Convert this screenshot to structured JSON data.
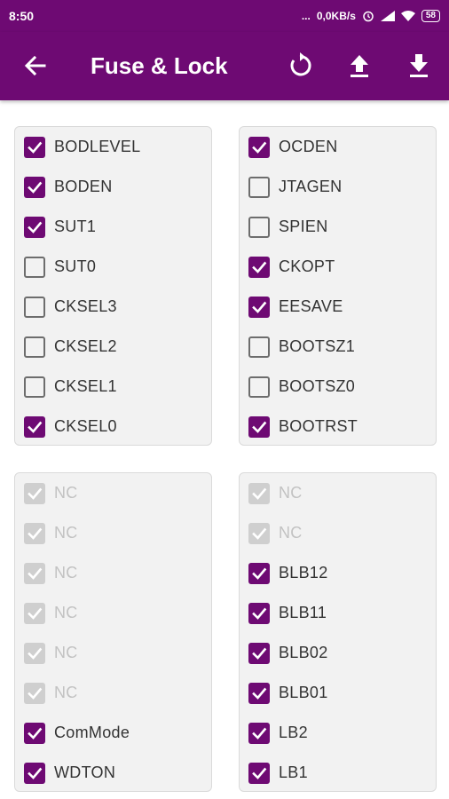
{
  "status_bar": {
    "time": "8:50",
    "dots": "...",
    "speed": "0,0KB/s",
    "battery": "58"
  },
  "app_bar": {
    "title": "Fuse & Lock",
    "icons": [
      "back-arrow-icon",
      "refresh-icon",
      "upload-icon",
      "download-icon"
    ]
  },
  "colors": {
    "accent": "#6e0a73",
    "panel_bg": "#f2f2f2",
    "disabled": "#cfcfcf"
  },
  "fuse_left": [
    {
      "label": "BODLEVEL",
      "checked": true,
      "disabled": false
    },
    {
      "label": "BODEN",
      "checked": true,
      "disabled": false
    },
    {
      "label": "SUT1",
      "checked": true,
      "disabled": false
    },
    {
      "label": "SUT0",
      "checked": false,
      "disabled": false
    },
    {
      "label": "CKSEL3",
      "checked": false,
      "disabled": false
    },
    {
      "label": "CKSEL2",
      "checked": false,
      "disabled": false
    },
    {
      "label": "CKSEL1",
      "checked": false,
      "disabled": false
    },
    {
      "label": "CKSEL0",
      "checked": true,
      "disabled": false
    }
  ],
  "fuse_right": [
    {
      "label": "OCDEN",
      "checked": true,
      "disabled": false
    },
    {
      "label": "JTAGEN",
      "checked": false,
      "disabled": false
    },
    {
      "label": "SPIEN",
      "checked": false,
      "disabled": false
    },
    {
      "label": "CKOPT",
      "checked": true,
      "disabled": false
    },
    {
      "label": "EESAVE",
      "checked": true,
      "disabled": false
    },
    {
      "label": "BOOTSZ1",
      "checked": false,
      "disabled": false
    },
    {
      "label": "BOOTSZ0",
      "checked": false,
      "disabled": false
    },
    {
      "label": "BOOTRST",
      "checked": true,
      "disabled": false
    }
  ],
  "lock_left": [
    {
      "label": "NC",
      "checked": true,
      "disabled": true
    },
    {
      "label": "NC",
      "checked": true,
      "disabled": true
    },
    {
      "label": "NC",
      "checked": true,
      "disabled": true
    },
    {
      "label": "NC",
      "checked": true,
      "disabled": true
    },
    {
      "label": "NC",
      "checked": true,
      "disabled": true
    },
    {
      "label": "NC",
      "checked": true,
      "disabled": true
    },
    {
      "label": "ComMode",
      "checked": true,
      "disabled": false
    },
    {
      "label": "WDTON",
      "checked": true,
      "disabled": false
    }
  ],
  "lock_right": [
    {
      "label": "NC",
      "checked": true,
      "disabled": true
    },
    {
      "label": "NC",
      "checked": true,
      "disabled": true
    },
    {
      "label": "BLB12",
      "checked": true,
      "disabled": false
    },
    {
      "label": "BLB11",
      "checked": true,
      "disabled": false
    },
    {
      "label": "BLB02",
      "checked": true,
      "disabled": false
    },
    {
      "label": "BLB01",
      "checked": true,
      "disabled": false
    },
    {
      "label": "LB2",
      "checked": true,
      "disabled": false
    },
    {
      "label": "LB1",
      "checked": true,
      "disabled": false
    }
  ]
}
